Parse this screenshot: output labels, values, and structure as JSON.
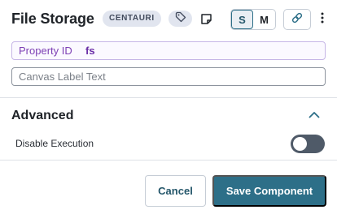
{
  "header": {
    "title": "File Storage",
    "badge": "CENTAURI",
    "size_options": [
      "S",
      "M"
    ],
    "selected_size": "S"
  },
  "fields": {
    "property_id_label": "Property ID",
    "property_id_value": "fs",
    "canvas_label_placeholder": "Canvas Label Text",
    "canvas_label_value": ""
  },
  "advanced": {
    "title": "Advanced",
    "expanded": true,
    "disable_execution_label": "Disable Execution",
    "disable_execution_on": false
  },
  "footer": {
    "cancel_label": "Cancel",
    "save_label": "Save Component"
  },
  "icons": {
    "tag": "tag-icon",
    "note": "note-icon",
    "link": "link-icon",
    "more": "more-vertical-icon",
    "collapse": "chevron-up-icon"
  },
  "colors": {
    "primary": "#2d6f88",
    "badge_bg": "#e1e5ef",
    "property_id_text": "#7d3fb4",
    "switch_off": "#4f5a68"
  }
}
